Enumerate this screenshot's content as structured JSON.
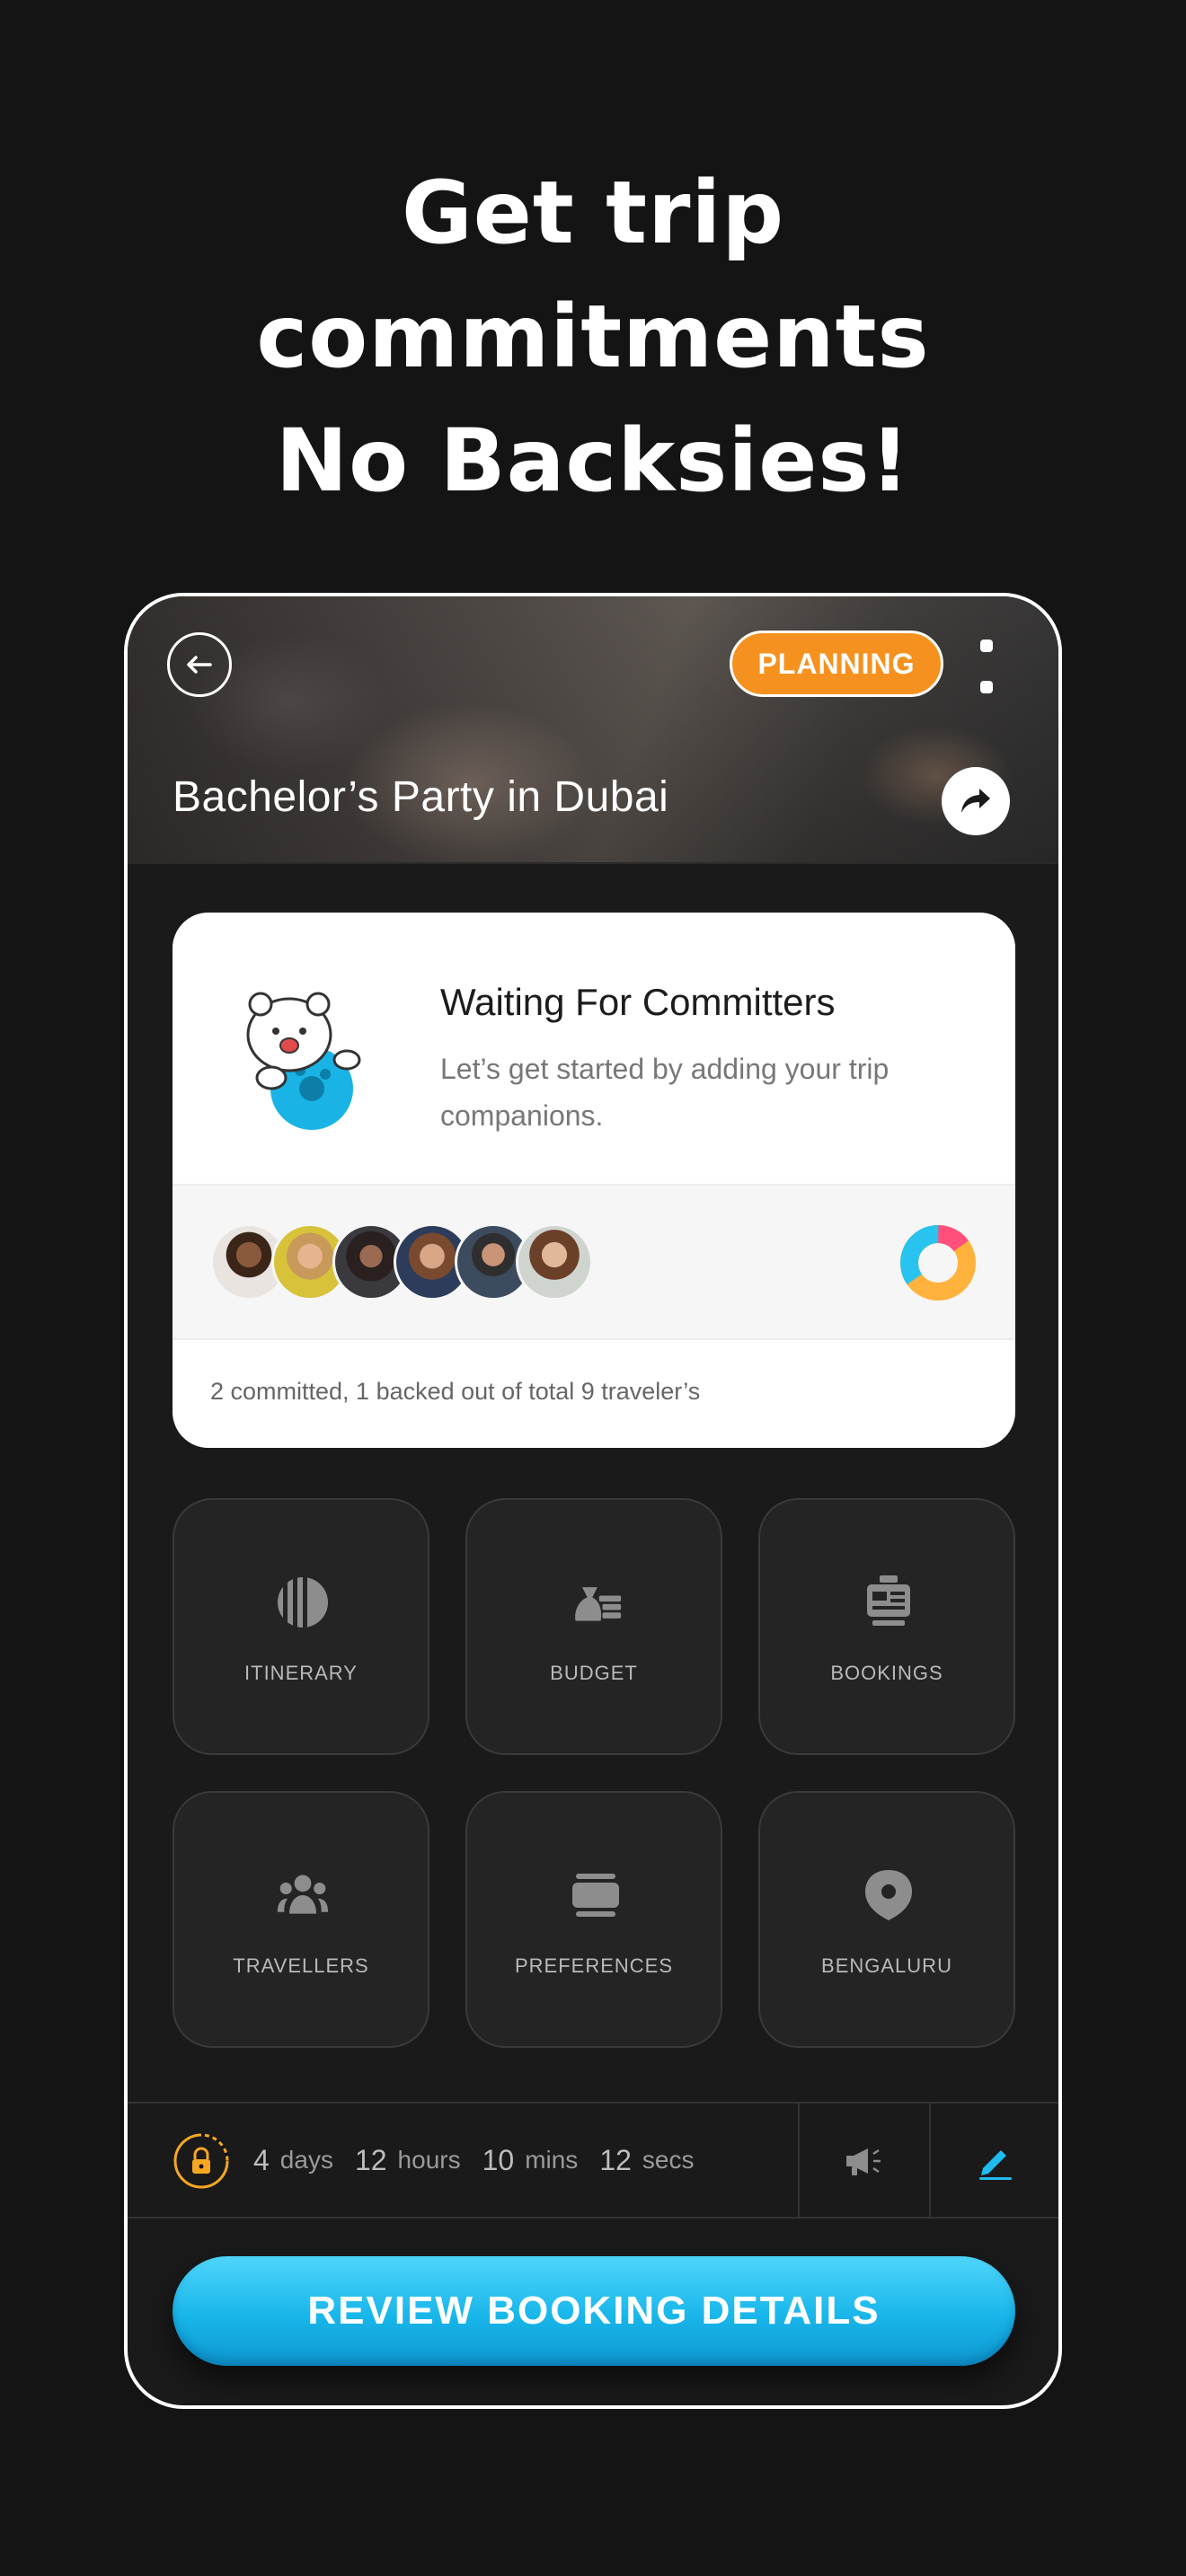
{
  "headline": [
    "Get trip",
    "commitments",
    "No Backsies!"
  ],
  "header": {
    "status_badge": "PLANNING",
    "trip_title": "Bachelor’s Party in Dubai"
  },
  "commit_card": {
    "title": "Waiting For Committers",
    "description": "Let’s get started by adding your trip companions.",
    "summary": "2 committed, 1 backed out of total 9 traveler’s",
    "donut_colors": [
      "#ff4f7a",
      "#29c3ef",
      "#ffb33c"
    ]
  },
  "tiles": [
    {
      "label": "ITINERARY",
      "icon": "itinerary-icon"
    },
    {
      "label": "BUDGET",
      "icon": "budget-icon"
    },
    {
      "label": "BOOKINGS",
      "icon": "bookings-icon"
    },
    {
      "label": "TRAVELLERS",
      "icon": "travellers-icon"
    },
    {
      "label": "PREFERENCES",
      "icon": "preferences-icon"
    },
    {
      "label": "BENGALURU",
      "icon": "location-icon"
    }
  ],
  "countdown": {
    "days": "4",
    "days_label": "days",
    "hours": "12",
    "hours_label": "hours",
    "mins": "10",
    "mins_label": "mins",
    "secs": "12",
    "secs_label": "secs"
  },
  "cta_label": "REVIEW BOOKING DETAILS",
  "colors": {
    "accent_orange": "#f5921f",
    "accent_cyan": "#1ebcef",
    "background": "#141414"
  }
}
